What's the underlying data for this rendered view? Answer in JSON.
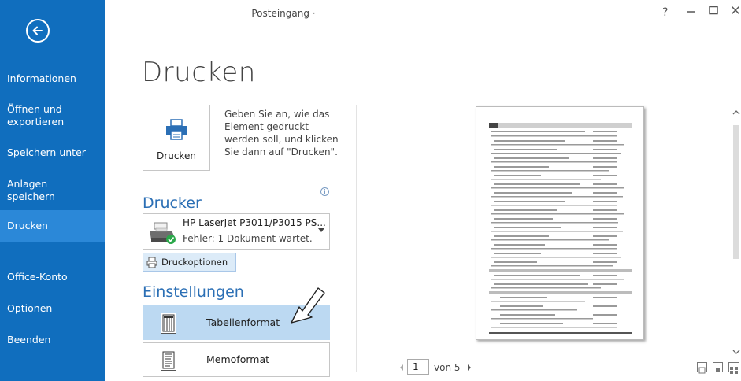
{
  "window": {
    "title": "Posteingang ·",
    "help": "?",
    "minimize": "—",
    "close": "✕"
  },
  "sidebar": {
    "items": [
      {
        "label": "Informationen"
      },
      {
        "label": "Öffnen und exportieren"
      },
      {
        "label": "Speichern unter"
      },
      {
        "label": "Anlagen speichern"
      },
      {
        "label": "Drucken"
      },
      {
        "label": "Office-Konto"
      },
      {
        "label": "Optionen"
      },
      {
        "label": "Beenden"
      }
    ],
    "active_index": 4,
    "background": "#106ebe",
    "active_background": "#2b88d8"
  },
  "main": {
    "heading": "Drucken",
    "print_button_label": "Drucken",
    "print_description": "Geben Sie an, wie das Element gedruckt werden soll, und klicken Sie dann auf \"Drucken\".",
    "printer_section_title": "Drucker",
    "info_icon": "i",
    "printer": {
      "name": "HP LaserJet P3011/P3015 PS...",
      "status": "Fehler: 1 Dokument wartet."
    },
    "printer_options_label": "Druckoptionen",
    "settings_section_title": "Einstellungen",
    "styles": [
      {
        "label": "Tabellenformat",
        "selected": true
      },
      {
        "label": "Memoformat",
        "selected": false
      }
    ]
  },
  "preview": {
    "page_prefix": "",
    "page_current": "1",
    "page_total_label": "von 5"
  }
}
